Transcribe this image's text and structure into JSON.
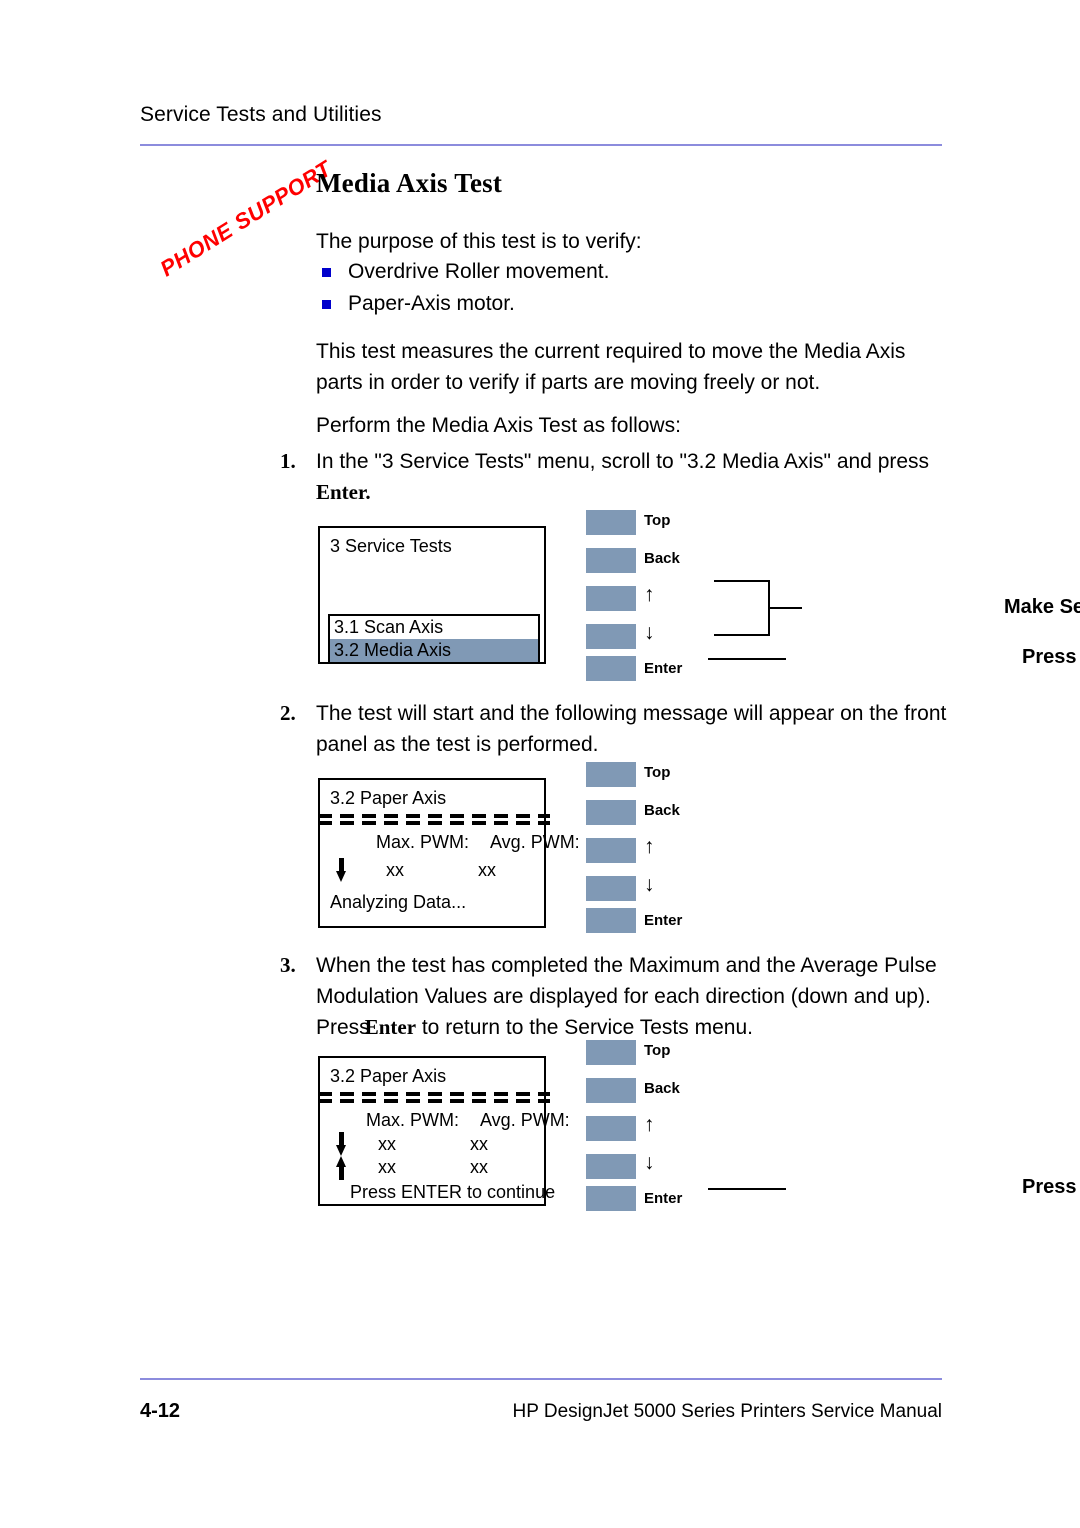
{
  "header": {
    "title": "Service Tests and Utilities"
  },
  "watermark": {
    "text": "PHONE SUPPORT",
    "color": "#ff0000"
  },
  "section": {
    "title": "Media Axis Test",
    "purpose_intro": "The purpose of this test is to verify:",
    "bullets": [
      "Overdrive Roller movement.",
      "Paper-Axis motor."
    ],
    "bullet_color": "#0000cc",
    "description": "This test measures the current required to move the Media Axis parts in order to verify if parts are moving freely or not.",
    "perform_intro": "Perform the Media Axis Test as follows:"
  },
  "steps": [
    {
      "number": "1.",
      "text_before": "In the \"3 Service Tests\" menu, scroll to \"3.2 Media Axis\" and press ",
      "emphasis": "Enter",
      "text_after": "."
    },
    {
      "number": "2.",
      "text_before": "The test will start and the following message will appear on the front panel as the test is performed.",
      "emphasis": "",
      "text_after": ""
    },
    {
      "number": "3.",
      "text_before": "When the test has completed the Maximum and the Average Pulse Modulation Values are displayed for each direction (down and up). Press",
      "emphasis": "Enter",
      "text_after": " to return to the Service Tests menu."
    }
  ],
  "figures": [
    {
      "lcd": {
        "title": "3 Service Tests",
        "menu": [
          {
            "label": "3.1 Scan Axis",
            "selected": false
          },
          {
            "label": "3.2 Media Axis",
            "selected": true
          }
        ]
      },
      "keys": [
        {
          "label": "Top",
          "type": "text"
        },
        {
          "label": "Back",
          "type": "text"
        },
        {
          "label": "↑",
          "type": "arrow"
        },
        {
          "label": "↓",
          "type": "arrow"
        },
        {
          "label": "Enter",
          "type": "text"
        }
      ],
      "annotations": {
        "make_selection": "Make Selection",
        "press_enter": "Press Enter"
      }
    },
    {
      "lcd": {
        "title": "3.2 Paper Axis",
        "col_headers": {
          "max": "Max. PWM:",
          "avg": "Avg. PWM:"
        },
        "rows": [
          {
            "direction": "down",
            "max": "xx",
            "avg": "xx"
          }
        ],
        "footer": "Analyzing Data..."
      },
      "keys": [
        {
          "label": "Top",
          "type": "text"
        },
        {
          "label": "Back",
          "type": "text"
        },
        {
          "label": "↑",
          "type": "arrow"
        },
        {
          "label": "↓",
          "type": "arrow"
        },
        {
          "label": "Enter",
          "type": "text"
        }
      ],
      "annotations": {
        "make_selection": "",
        "press_enter": ""
      }
    },
    {
      "lcd": {
        "title": "3.2 Paper Axis",
        "col_headers": {
          "max": "Max. PWM:",
          "avg": "Avg. PWM:"
        },
        "rows": [
          {
            "direction": "down",
            "max": "xx",
            "avg": "xx"
          },
          {
            "direction": "up",
            "max": "xx",
            "avg": "xx"
          }
        ],
        "footer": "Press ENTER to continue"
      },
      "keys": [
        {
          "label": "Top",
          "type": "text"
        },
        {
          "label": "Back",
          "type": "text"
        },
        {
          "label": "↑",
          "type": "arrow"
        },
        {
          "label": "↓",
          "type": "arrow"
        },
        {
          "label": "Enter",
          "type": "text"
        }
      ],
      "annotations": {
        "make_selection": "",
        "press_enter": "Press Enter"
      }
    }
  ],
  "footer": {
    "page_number": "4-12",
    "manual_title": "HP DesignJet 5000 Series Printers Service Manual"
  },
  "colors": {
    "rule": "#8c8cdd",
    "key_cap": "#8099b5",
    "selection": "#8099b5"
  }
}
